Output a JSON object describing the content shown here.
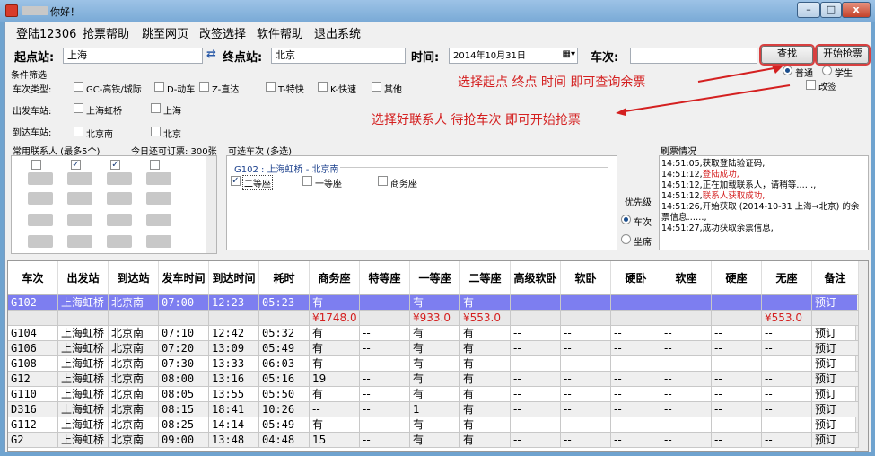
{
  "window": {
    "title": "你好！",
    "min": "–",
    "max": "□",
    "close": "x"
  },
  "menu": [
    "登陆12306",
    "抢票帮助",
    "跳至网页",
    "改签选择",
    "软件帮助",
    "退出系统"
  ],
  "search": {
    "from_label": "起点站:",
    "from_value": "上海",
    "swap": "⇄",
    "to_label": "终点站:",
    "to_value": "北京",
    "time_label": "时间:",
    "date_value": "2014年10月31日",
    "train_label": "车次:",
    "train_value": "",
    "query_btn": "查找",
    "start_btn": "开始抢票"
  },
  "passenger_type": {
    "normal": "普通",
    "student": "学生",
    "change": "改签"
  },
  "filters": {
    "title": "条件筛选",
    "type_label": "车次类型:",
    "types": [
      "GC-高铁/城际",
      "D-动车",
      "Z-直达",
      "T-特快",
      "K-快速",
      "其他"
    ],
    "depart_label": "出发车站:",
    "departs": [
      "上海虹桥",
      "上海"
    ],
    "arrive_label": "到达车站:",
    "arrives": [
      "北京南",
      "北京"
    ]
  },
  "annotations": {
    "a1": "选择起点  终点  时间 即可查询余票",
    "a2": "选择好联系人 待抢车次 即可开始抢票"
  },
  "contacts": {
    "title": "常用联系人 (最多5个)",
    "today": "今日还可订票: 300张"
  },
  "trains_box": {
    "title": "可选车次 (多选)",
    "group_title": "G102 : 上海虹桥 - 北京南",
    "seats": [
      "二等座",
      "一等座",
      "商务座"
    ],
    "priority_title": "优先级",
    "opt_train": "车次",
    "opt_seat": "坐席"
  },
  "log": {
    "title": "刷票情况",
    "lines": [
      {
        "t": "14:51:05,",
        "m": "获取登陆验证码,",
        "red": false
      },
      {
        "t": "14:51:12,",
        "m": "登陆成功,",
        "red": true
      },
      {
        "t": "14:51:12,",
        "m": "正在加载联系人，请稍等……,",
        "red": false
      },
      {
        "t": "14:51:12,",
        "m": "联系人获取成功,",
        "red": true
      },
      {
        "t": "14:51:26,",
        "m": "开始获取 (2014-10-31 上海→北京) 的余票信息……,",
        "red": false
      },
      {
        "t": "14:51:27,",
        "m": "成功获取余票信息,",
        "red": false
      }
    ]
  },
  "table": {
    "headers": [
      "车次",
      "出发站",
      "到达站",
      "发车时间",
      "到达时间",
      "耗时",
      "商务座",
      "特等座",
      "一等座",
      "二等座",
      "高级软卧",
      "软卧",
      "硬卧",
      "软座",
      "硬座",
      "无座",
      "备注"
    ],
    "rows": [
      {
        "c": [
          "G102",
          "上海虹桥",
          "北京南",
          "07:00",
          "12:23",
          "05:23",
          "有",
          "--",
          "有",
          "有",
          "--",
          "--",
          "--",
          "--",
          "--",
          "--",
          "预订"
        ],
        "sel": true
      },
      {
        "c": [
          "",
          "",
          "",
          "",
          "",
          "",
          "¥1748.0",
          "",
          "¥933.0",
          "¥553.0",
          "",
          "",
          "",
          "",
          "",
          "¥553.0",
          ""
        ],
        "price": true
      },
      {
        "c": [
          "G104",
          "上海虹桥",
          "北京南",
          "07:10",
          "12:42",
          "05:32",
          "有",
          "--",
          "有",
          "有",
          "--",
          "--",
          "--",
          "--",
          "--",
          "--",
          "预订"
        ]
      },
      {
        "c": [
          "G106",
          "上海虹桥",
          "北京南",
          "07:20",
          "13:09",
          "05:49",
          "有",
          "--",
          "有",
          "有",
          "--",
          "--",
          "--",
          "--",
          "--",
          "--",
          "预订"
        ]
      },
      {
        "c": [
          "G108",
          "上海虹桥",
          "北京南",
          "07:30",
          "13:33",
          "06:03",
          "有",
          "--",
          "有",
          "有",
          "--",
          "--",
          "--",
          "--",
          "--",
          "--",
          "预订"
        ]
      },
      {
        "c": [
          "G12",
          "上海虹桥",
          "北京南",
          "08:00",
          "13:16",
          "05:16",
          "19",
          "--",
          "有",
          "有",
          "--",
          "--",
          "--",
          "--",
          "--",
          "--",
          "预订"
        ]
      },
      {
        "c": [
          "G110",
          "上海虹桥",
          "北京南",
          "08:05",
          "13:55",
          "05:50",
          "有",
          "--",
          "有",
          "有",
          "--",
          "--",
          "--",
          "--",
          "--",
          "--",
          "预订"
        ]
      },
      {
        "c": [
          "D316",
          "上海虹桥",
          "北京南",
          "08:15",
          "18:41",
          "10:26",
          "--",
          "--",
          "1",
          "有",
          "--",
          "--",
          "--",
          "--",
          "--",
          "--",
          "预订"
        ]
      },
      {
        "c": [
          "G112",
          "上海虹桥",
          "北京南",
          "08:25",
          "14:14",
          "05:49",
          "有",
          "--",
          "有",
          "有",
          "--",
          "--",
          "--",
          "--",
          "--",
          "--",
          "预订"
        ]
      },
      {
        "c": [
          "G2",
          "上海虹桥",
          "北京南",
          "09:00",
          "13:48",
          "04:48",
          "15",
          "--",
          "有",
          "有",
          "--",
          "--",
          "--",
          "--",
          "--",
          "--",
          "预订"
        ]
      }
    ]
  }
}
